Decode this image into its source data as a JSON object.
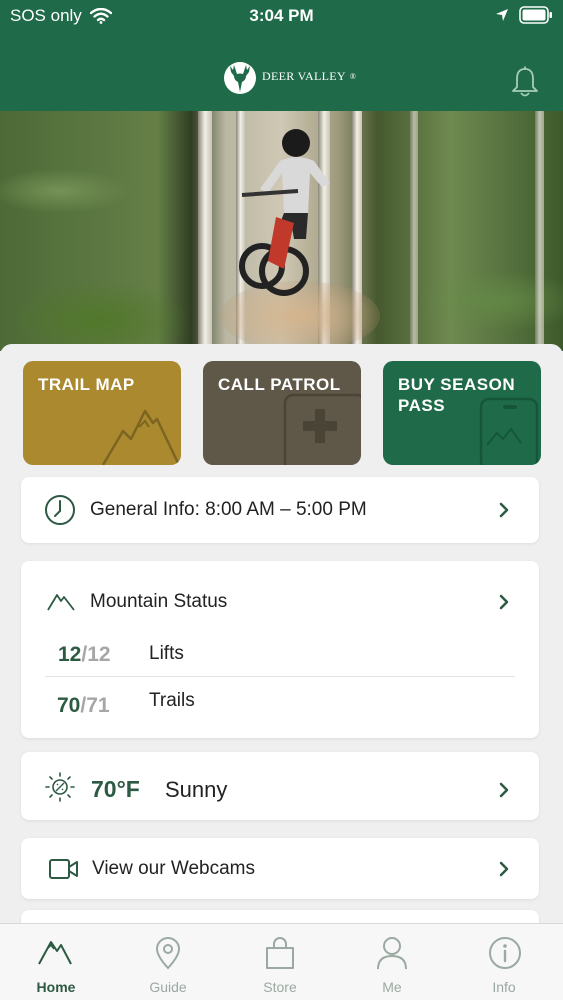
{
  "status_bar": {
    "carrier": "SOS only",
    "time": "3:04 PM"
  },
  "header": {
    "logo_text": "DEER VALLEY",
    "logo_mark": "®"
  },
  "tiles": [
    {
      "label": "TRAIL MAP",
      "icon": "mountain-icon",
      "color": "#ab8a2f"
    },
    {
      "label": "CALL PATROL",
      "icon": "first-aid-icon",
      "color": "#5f5849"
    },
    {
      "label": "BUY SEASON PASS",
      "icon": "pass-card-icon",
      "color": "#1f6b49"
    }
  ],
  "general_info": {
    "label": "General Info: 8:00 AM – 5:00 PM"
  },
  "mountain_status": {
    "title": "Mountain Status",
    "rows": [
      {
        "open": "12",
        "total": "/12",
        "label": "Lifts"
      },
      {
        "open": "70",
        "total": "/71",
        "label": "Trails"
      }
    ]
  },
  "weather": {
    "temperature": "70°F",
    "condition": "Sunny"
  },
  "webcams": {
    "label": "View our Webcams"
  },
  "tabs": [
    {
      "label": "Home",
      "icon": "home-mountain-icon",
      "active": true
    },
    {
      "label": "Guide",
      "icon": "map-pin-icon",
      "active": false
    },
    {
      "label": "Store",
      "icon": "shopping-bag-icon",
      "active": false
    },
    {
      "label": "Me",
      "icon": "person-icon",
      "active": false
    },
    {
      "label": "Info",
      "icon": "info-icon",
      "active": false
    }
  ],
  "colors": {
    "brand_green": "#1f6b49",
    "trail_map_gold": "#ab8a2f",
    "patrol_brown": "#5f5849",
    "stat_green": "#2c5a42"
  }
}
